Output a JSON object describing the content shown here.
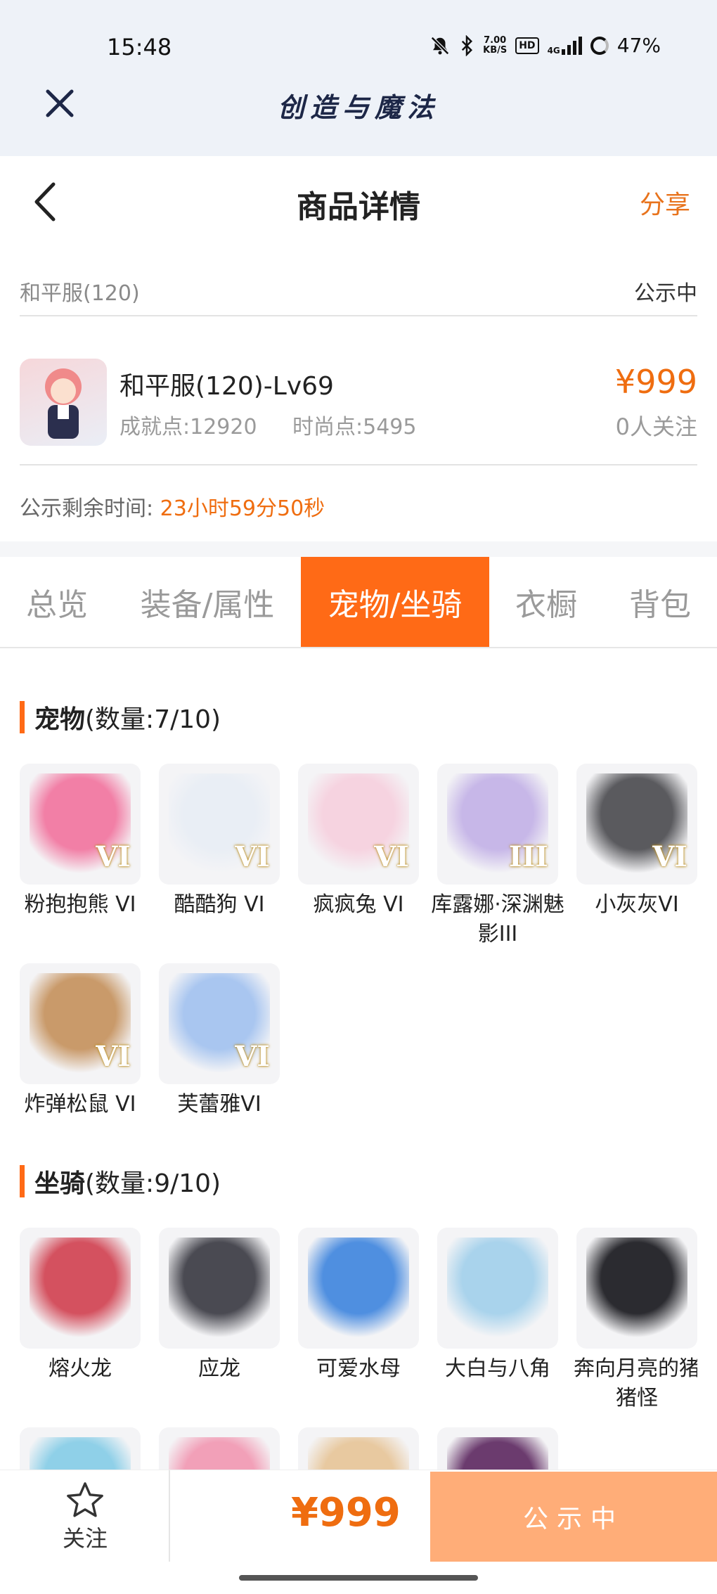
{
  "status_bar": {
    "time": "15:48",
    "net_speed_top": "7.00",
    "net_speed_bottom": "KB/S",
    "hd": "HD",
    "network": "4G",
    "battery": "47%",
    "icons": [
      "bell-muted-icon",
      "bluetooth-icon",
      "signal-icon",
      "battery-ring-icon"
    ]
  },
  "app_header": {
    "title": "创造与魔法",
    "close_icon": "close-icon"
  },
  "nav": {
    "title": "商品详情",
    "share": "分享",
    "back_icon": "chevron-left-icon"
  },
  "server": {
    "name": "和平服(120)",
    "status": "公示中"
  },
  "character": {
    "name": "和平服(120)-Lv69",
    "achievement": "成就点:12920",
    "fashion": "时尚点:5495",
    "price": "¥999",
    "followers": "0人关注"
  },
  "timer": {
    "label": "公示剩余时间:",
    "value": "23小时59分50秒"
  },
  "tabs": [
    {
      "label": "总览",
      "active": false
    },
    {
      "label": "装备/属性",
      "active": false
    },
    {
      "label": "宠物/坐骑",
      "active": true
    },
    {
      "label": "衣橱",
      "active": false
    },
    {
      "label": "背包",
      "active": false
    }
  ],
  "pets": {
    "title": "宠物",
    "count": "(数量:7/10)",
    "items": [
      {
        "name": "粉抱抱熊 VI",
        "tier": "VI",
        "color": "#f27fa6"
      },
      {
        "name": "酷酷狗 VI",
        "tier": "VI",
        "color": "#e9eef5"
      },
      {
        "name": "疯疯兔 VI",
        "tier": "VI",
        "color": "#f6d3e0"
      },
      {
        "name": "库露娜·深渊魅影III",
        "tier": "III",
        "color": "#c7b7e8"
      },
      {
        "name": "小灰灰VI",
        "tier": "VI",
        "color": "#5a5a5e"
      },
      {
        "name": "炸弹松鼠 VI",
        "tier": "VI",
        "color": "#c99a6a"
      },
      {
        "name": "芙蕾雅VI",
        "tier": "VI",
        "color": "#a9c6f0"
      }
    ]
  },
  "mounts": {
    "title": "坐骑",
    "count": "(数量:9/10)",
    "items": [
      {
        "name": "熔火龙",
        "color": "#d4515f"
      },
      {
        "name": "应龙",
        "color": "#4a4a52"
      },
      {
        "name": "可爱水母",
        "color": "#4f8fe0"
      },
      {
        "name": "大白与八角",
        "color": "#a9d3ec"
      },
      {
        "name": "奔向月亮的猪猪怪",
        "color": "#2b2b30"
      },
      {
        "name": "",
        "color": "#8fd0e8"
      },
      {
        "name": "",
        "color": "#f2a0b8"
      },
      {
        "name": "",
        "color": "#e8c9a0"
      },
      {
        "name": "",
        "color": "#6b3b6e"
      }
    ]
  },
  "bottom_bar": {
    "follow_label": "关注",
    "price": "¥999",
    "button": "公示中"
  }
}
